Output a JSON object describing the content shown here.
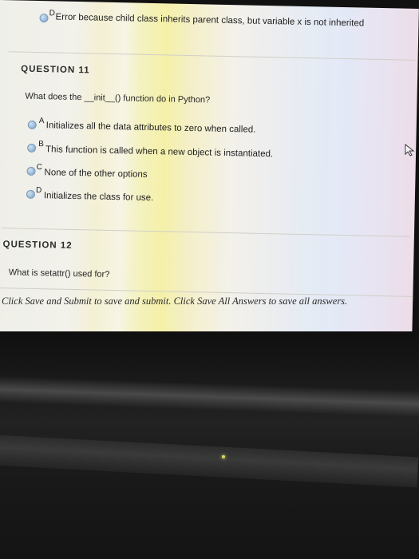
{
  "prev_question": {
    "option_d": {
      "letter": "D",
      "text": "Error because child class inherits parent class, but variable x is not inherited"
    }
  },
  "q11": {
    "heading": "QUESTION 11",
    "prompt": "What does the __init__() function do in Python?",
    "options": [
      {
        "letter": "A",
        "text": "Initializes all the data attributes to zero when called."
      },
      {
        "letter": "B",
        "text": "This function is called when a new object is instantiated."
      },
      {
        "letter": "C",
        "text": "None of the other options"
      },
      {
        "letter": "D",
        "text": "Initializes the class for use."
      }
    ]
  },
  "q12": {
    "heading": "QUESTION 12",
    "prompt": "What is setattr() used for?"
  },
  "footer": {
    "part1": "Click Save and Submit to save and submit. Click Save All Answers to save all answers."
  }
}
